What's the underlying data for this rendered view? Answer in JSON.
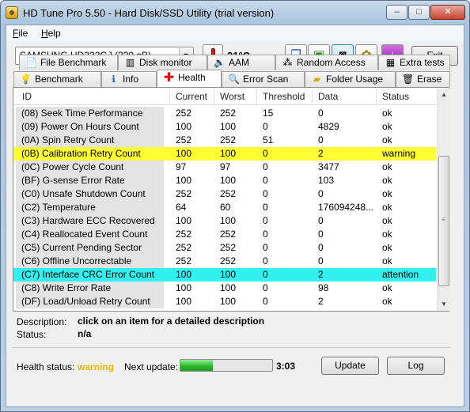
{
  "window": {
    "title": "HD Tune Pro 5.50 - Hard Disk/SSD Utility (trial version)",
    "controls": {
      "minimize": "–",
      "maximize": "□",
      "close": "✕"
    }
  },
  "menu": {
    "file_first": "F",
    "file_rest": "ile",
    "help_first": "H",
    "help_rest": "elp"
  },
  "toolbar": {
    "drive": "SAMSUNG HD322GJ (320 gB)",
    "temperature": "31°C",
    "exit_label": "Exit",
    "icons": [
      "copy-info-icon",
      "copy-screenshot-icon",
      "camera-icon",
      "settings-icon",
      "download-icon"
    ]
  },
  "tabs": {
    "row1": [
      {
        "label": "File Benchmark",
        "icon": "file-benchmark-icon"
      },
      {
        "label": "Disk monitor",
        "icon": "disk-monitor-icon"
      },
      {
        "label": "AAM",
        "icon": "speaker-icon"
      },
      {
        "label": "Random Access",
        "icon": "random-access-icon"
      },
      {
        "label": "Extra tests",
        "icon": "extra-tests-icon"
      }
    ],
    "row2": [
      {
        "label": "Benchmark",
        "icon": "benchmark-icon"
      },
      {
        "label": "Info",
        "icon": "info-icon"
      },
      {
        "label": "Health",
        "icon": "health-cross-icon",
        "active": true
      },
      {
        "label": "Error Scan",
        "icon": "magnifier-icon"
      },
      {
        "label": "Folder Usage",
        "icon": "folder-icon"
      },
      {
        "label": "Erase",
        "icon": "trash-icon"
      }
    ]
  },
  "table": {
    "headers": [
      "ID",
      "Current",
      "Worst",
      "Threshold",
      "Data",
      "Status"
    ],
    "rows": [
      [
        "(08) Seek Time Performance",
        "252",
        "252",
        "15",
        "0",
        "ok"
      ],
      [
        "(09) Power On Hours Count",
        "100",
        "100",
        "0",
        "4829",
        "ok"
      ],
      [
        "(0A) Spin Retry Count",
        "252",
        "252",
        "51",
        "0",
        "ok"
      ],
      [
        "(0B) Calibration Retry Count",
        "100",
        "100",
        "0",
        "2",
        "warning"
      ],
      [
        "(0C) Power Cycle Count",
        "97",
        "97",
        "0",
        "3477",
        "ok"
      ],
      [
        "(BF) G-sense Error Rate",
        "100",
        "100",
        "0",
        "103",
        "ok"
      ],
      [
        "(C0) Unsafe Shutdown Count",
        "252",
        "252",
        "0",
        "0",
        "ok"
      ],
      [
        "(C2) Temperature",
        "64",
        "60",
        "0",
        "176094248...",
        "ok"
      ],
      [
        "(C3) Hardware ECC Recovered",
        "100",
        "100",
        "0",
        "0",
        "ok"
      ],
      [
        "(C4) Reallocated Event Count",
        "252",
        "252",
        "0",
        "0",
        "ok"
      ],
      [
        "(C5) Current Pending Sector",
        "252",
        "252",
        "0",
        "0",
        "ok"
      ],
      [
        "(C6) Offline Uncorrectable",
        "252",
        "252",
        "0",
        "0",
        "ok"
      ],
      [
        "(C7) Interface CRC Error Count",
        "100",
        "100",
        "0",
        "2",
        "attention"
      ],
      [
        "(C8) Write Error Rate",
        "100",
        "100",
        "0",
        "98",
        "ok"
      ],
      [
        "(DF) Load/Unload Retry Count",
        "100",
        "100",
        "0",
        "2",
        "ok"
      ]
    ],
    "row_colors": {
      "warning": "#ffff33",
      "attention": "#33f0f0"
    }
  },
  "details": {
    "description_label": "Description:",
    "description_value": "click on an item for a detailed description",
    "status_label": "Status:",
    "status_value": "n/a"
  },
  "footer": {
    "health_label": "Health status:",
    "health_value": "warning",
    "health_color": "#e6b800",
    "next_update_label": "Next update:",
    "progress_percent": 35,
    "countdown": "3:03",
    "update_label": "Update",
    "log_label": "Log"
  }
}
